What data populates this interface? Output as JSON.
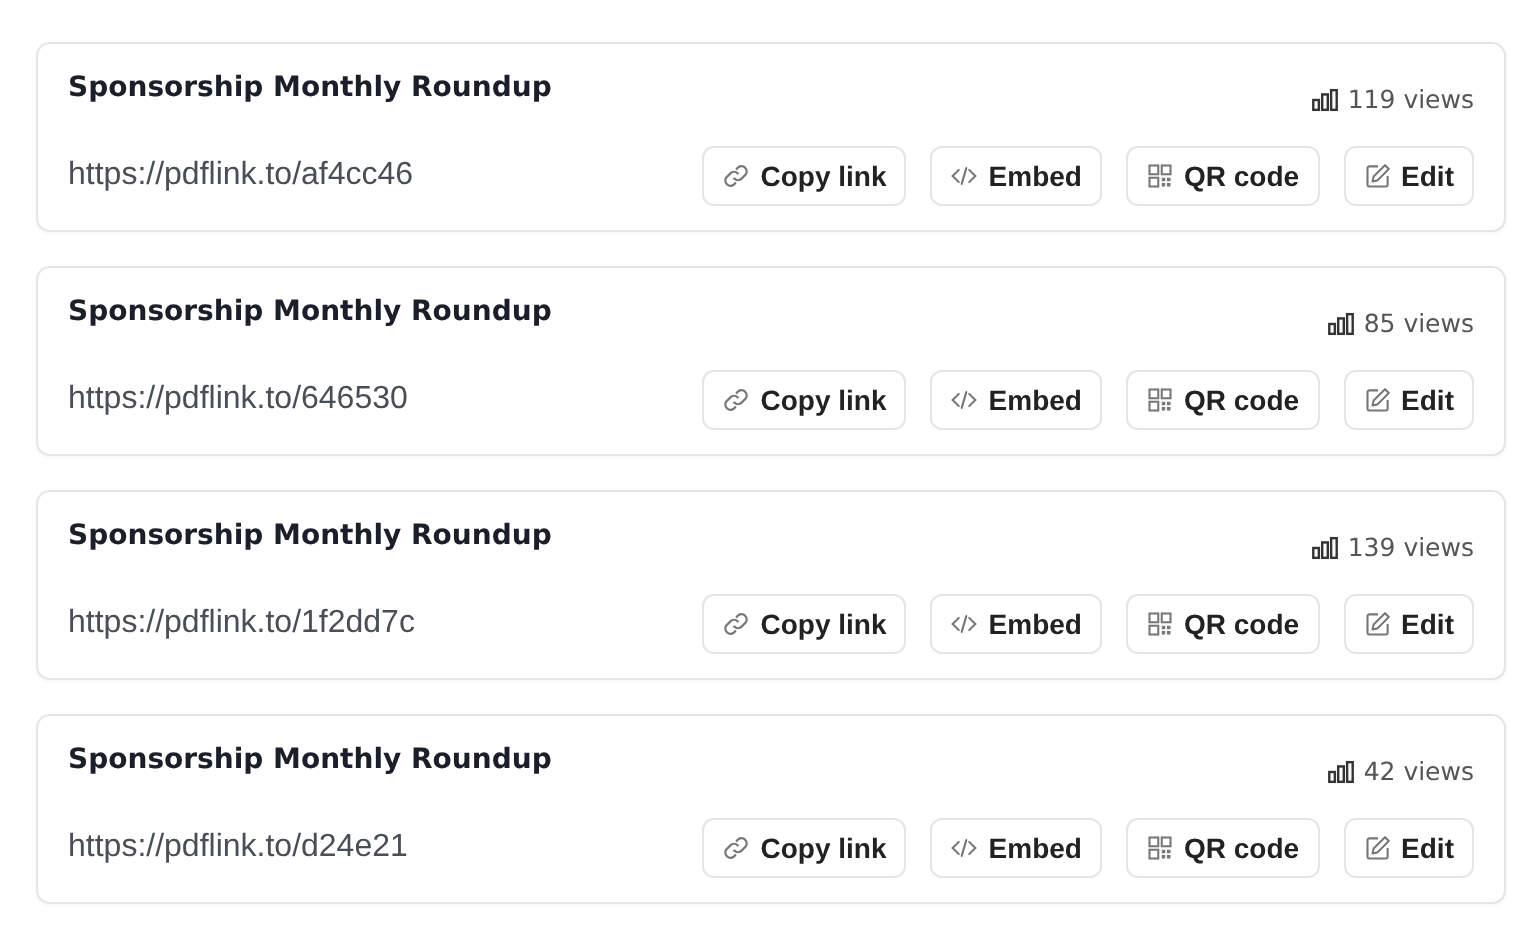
{
  "links": [
    {
      "title": "Sponsorship Monthly Roundup",
      "views": "119 views",
      "url": "https://pdflink.to/af4cc46",
      "actions": [
        {
          "kind": "link",
          "label": "Copy link"
        },
        {
          "kind": "embed",
          "label": "Embed"
        },
        {
          "kind": "qr",
          "label": "QR code"
        },
        {
          "kind": "edit",
          "label": "Edit"
        }
      ]
    },
    {
      "title": "Sponsorship Monthly Roundup",
      "views": "85 views",
      "url": "https://pdflink.to/646530",
      "actions": [
        {
          "kind": "link",
          "label": "Copy link"
        },
        {
          "kind": "embed",
          "label": "Embed"
        },
        {
          "kind": "qr",
          "label": "QR code"
        },
        {
          "kind": "edit",
          "label": "Edit"
        }
      ]
    },
    {
      "title": "Sponsorship Monthly Roundup",
      "views": "139 views",
      "url": "https://pdflink.to/1f2dd7c",
      "actions": [
        {
          "kind": "link",
          "label": "Copy link"
        },
        {
          "kind": "embed",
          "label": "Embed"
        },
        {
          "kind": "qr",
          "label": "QR code"
        },
        {
          "kind": "edit",
          "label": "Edit"
        }
      ]
    },
    {
      "title": "Sponsorship Monthly Roundup",
      "views": "42 views",
      "url": "https://pdflink.to/d24e21",
      "actions": [
        {
          "kind": "link",
          "label": "Copy link"
        },
        {
          "kind": "embed",
          "label": "Embed"
        },
        {
          "kind": "qr",
          "label": "QR code"
        },
        {
          "kind": "edit",
          "label": "Edit"
        }
      ]
    }
  ]
}
